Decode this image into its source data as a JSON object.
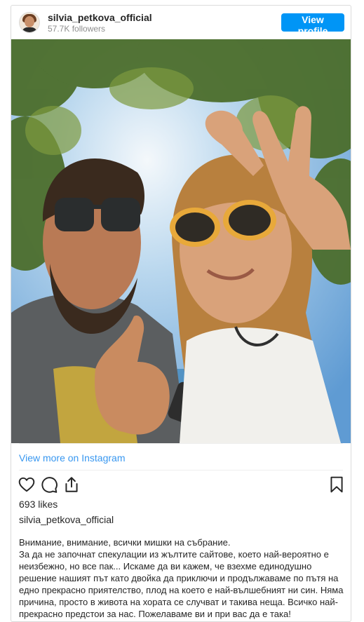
{
  "header": {
    "username": "silvia_petkova_official",
    "followers": "57.7K followers",
    "view_profile_label": "View profile"
  },
  "photo": {
    "alt": "Selfie of a man and a woman in sunglasses outdoors under trees"
  },
  "view_more_label": "View more on Instagram",
  "actions": {
    "icons": [
      "heart-icon",
      "comment-icon",
      "share-icon",
      "bookmark-icon"
    ]
  },
  "likes": "693 likes",
  "caption": {
    "username": "silvia_petkova_official",
    "text": "Внимание, внимание, всички мишки на събрание.\nЗа да не започнат спекулации из жълтите сайтове, което най-вероятно е неизбежно, но все пак... Искаме да ви кажем, че взехме единодушно решение нашият път като двойка да приключи и продължаваме по пътя на едно прекрасно приятелство, плод на което е най-вълшебният ни син. Няма причина, просто в живота на хората се случват и такива неща. Всичко най-прекрасно предстои за нас. Пожелаваме ви и при вас да е така!"
  },
  "colors": {
    "accent": "#0095f6",
    "link": "#3897f0",
    "border": "#dbdbdb",
    "muted": "#8e8e8e"
  }
}
